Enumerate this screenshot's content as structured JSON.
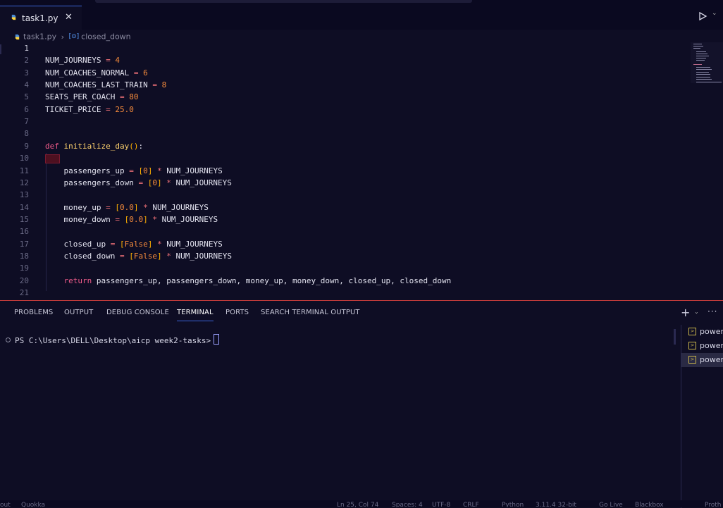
{
  "editor_tab": {
    "filename": "task1.py",
    "close_glyph": "✕"
  },
  "breadcrumb": {
    "file": "task1.py",
    "separator": "›",
    "symbol": "closed_down"
  },
  "code_lines": [
    {
      "n": "1",
      "t": ""
    },
    {
      "n": "2",
      "t": "NUM_JOURNEYS = 4"
    },
    {
      "n": "3",
      "t": "NUM_COACHES_NORMAL = 6"
    },
    {
      "n": "4",
      "t": "NUM_COACHES_LAST_TRAIN = 8"
    },
    {
      "n": "5",
      "t": "SEATS_PER_COACH = 80"
    },
    {
      "n": "6",
      "t": "TICKET_PRICE = 25.0"
    },
    {
      "n": "7",
      "t": ""
    },
    {
      "n": "8",
      "t": ""
    },
    {
      "n": "9",
      "t": "def initialize_day():"
    },
    {
      "n": "10",
      "t": ""
    },
    {
      "n": "11",
      "t": "    passengers_up = [0] * NUM_JOURNEYS"
    },
    {
      "n": "12",
      "t": "    passengers_down = [0] * NUM_JOURNEYS"
    },
    {
      "n": "13",
      "t": ""
    },
    {
      "n": "14",
      "t": "    money_up = [0.0] * NUM_JOURNEYS"
    },
    {
      "n": "15",
      "t": "    money_down = [0.0] * NUM_JOURNEYS"
    },
    {
      "n": "16",
      "t": ""
    },
    {
      "n": "17",
      "t": "    closed_up = [False] * NUM_JOURNEYS"
    },
    {
      "n": "18",
      "t": "    closed_down = [False] * NUM_JOURNEYS"
    },
    {
      "n": "19",
      "t": ""
    },
    {
      "n": "20",
      "t": "    return passengers_up, passengers_down, money_up, money_down, closed_up, closed_down"
    },
    {
      "n": "21",
      "t": ""
    }
  ],
  "panel_tabs": [
    "PROBLEMS",
    "OUTPUT",
    "DEBUG CONSOLE",
    "TERMINAL",
    "PORTS",
    "SEARCH TERMINAL OUTPUT"
  ],
  "panel_active_tab": "TERMINAL",
  "terminal": {
    "prompt": "PS C:\\Users\\DELL\\Desktop\\aicp week2-tasks>"
  },
  "terminal_list": [
    "power",
    "power",
    "power"
  ],
  "panel_actions": {
    "add": "+",
    "chevron": "⌄",
    "more": "···"
  },
  "status_bar": [
    "out",
    "Quokka",
    "Ln 25, Col 74",
    "Spaces: 4",
    "UTF-8",
    "CRLF",
    "Python",
    "3.11.4 32-bit",
    "Go Live",
    "Blackbox",
    "Proth"
  ],
  "colors": {
    "accent": "#3a64d8",
    "panel_border": "#c03a3a",
    "background": "#0e0d24"
  }
}
